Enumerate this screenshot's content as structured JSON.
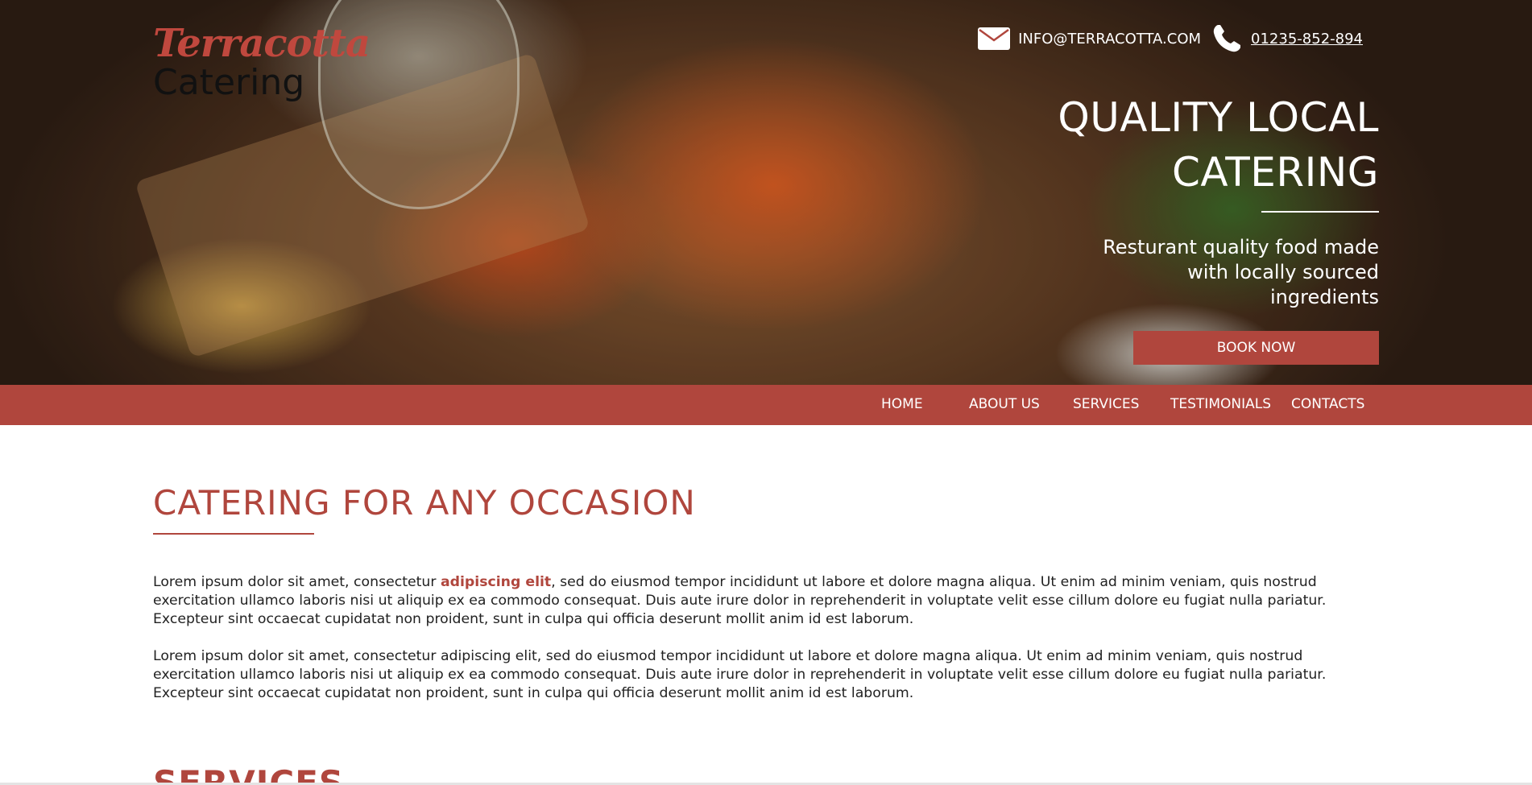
{
  "brand": {
    "name_top": "Terracotta",
    "name_bottom": "Catering"
  },
  "contact": {
    "email": "INFO@TERRACOTTA.COM",
    "phone": "01235-852-894",
    "email_icon": "envelope-icon",
    "phone_icon": "phone-icon"
  },
  "hero": {
    "title_line1": "QUALITY LOCAL",
    "title_line2": "CATERING",
    "sub_line1": "Resturant quality food made",
    "sub_line2": "with locally sourced",
    "sub_line3": "ingredients",
    "cta": "BOOK NOW"
  },
  "nav": {
    "items": [
      "HOME",
      "ABOUT US",
      "SERVICES",
      "TESTIMONIALS",
      "CONTACTS"
    ]
  },
  "main": {
    "heading": "CATERING FOR ANY OCCASION",
    "para1_before": "Lorem ipsum dolor sit amet, consectetur ",
    "para1_link": "adipiscing elit",
    "para1_after": ", sed do eiusmod tempor incididunt ut labore et dolore magna aliqua. Ut enim ad minim veniam, quis nostrud exercitation ullamco laboris nisi ut aliquip ex ea commodo consequat. Duis aute irure dolor in reprehenderit in voluptate velit esse cillum dolore eu fugiat nulla pariatur. Excepteur sint occaecat cupidatat non proident, sunt in culpa qui officia deserunt mollit anim id est laborum.",
    "para2": "Lorem ipsum dolor sit amet, consectetur adipiscing elit, sed do eiusmod tempor incididunt ut labore et dolore magna aliqua. Ut enim ad minim veniam, quis nostrud exercitation ullamco laboris nisi ut aliquip ex ea commodo consequat. Duis aute irure dolor in reprehenderit in voluptate velit esse cillum dolore eu fugiat nulla pariatur. Excepteur sint occaecat cupidatat non proident, sunt in culpa qui officia deserunt mollit anim id est laborum.",
    "next_heading": "SERVICES"
  },
  "colors": {
    "accent": "#b0463d",
    "brand_script": "#c0483e",
    "text": "#222222",
    "white": "#ffffff"
  }
}
